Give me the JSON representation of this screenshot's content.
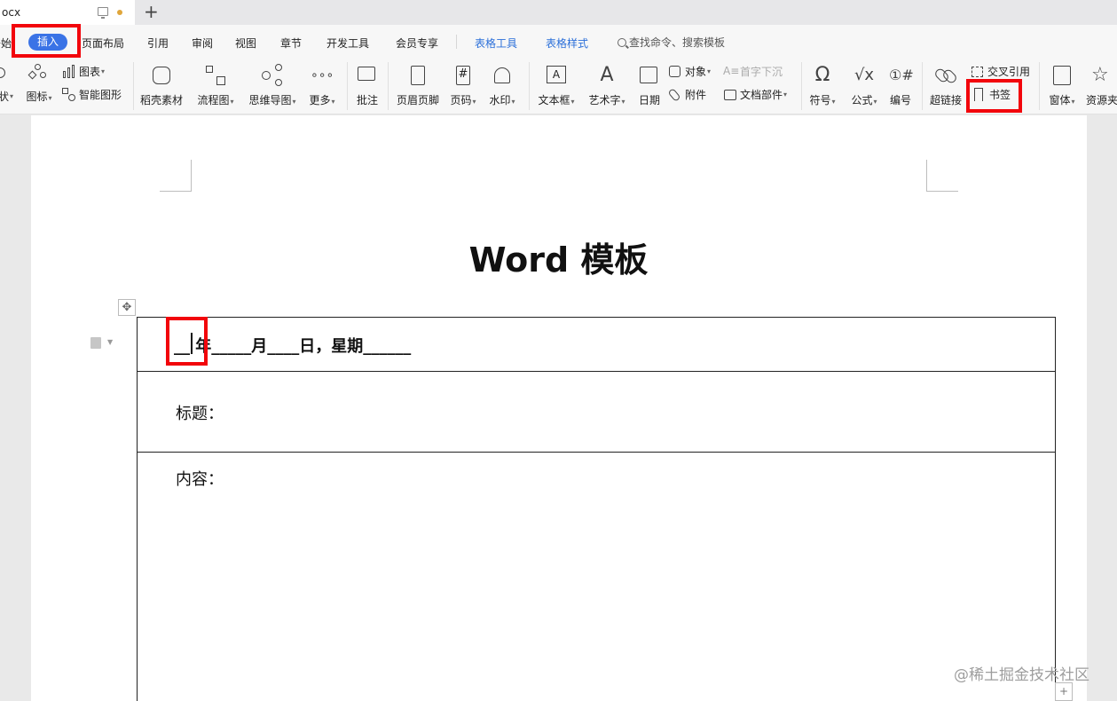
{
  "tab": {
    "doc_name": "ocx",
    "new_tab_label": "+"
  },
  "menu": {
    "start_partial": "开始",
    "insert": "插入",
    "layout": "页面布局",
    "reference": "引用",
    "review": "审阅",
    "view": "视图",
    "section": "章节",
    "dev": "开发工具",
    "member": "会员专享",
    "table_tools": "表格工具",
    "table_style": "表格样式",
    "search": "查找命令、搜索模板"
  },
  "ribbon": {
    "shape_partial": "状",
    "icon_lib": "图标",
    "chart": "图表",
    "smart_shape": "智能图形",
    "material": "稻壳素材",
    "flowchart": "流程图",
    "mindmap": "思维导图",
    "more": "更多",
    "comment": "批注",
    "header_footer": "页眉页脚",
    "page_num": "页码",
    "watermark": "水印",
    "textbox": "文本框",
    "wordart": "艺术字",
    "date": "日期",
    "object": "对象",
    "attachment": "附件",
    "dropcap": "首字下沉",
    "doc_parts": "文档部件",
    "symbol": "符号",
    "formula": "公式",
    "numbering": "编号",
    "hyperlink": "超链接",
    "crossref": "交叉引用",
    "bookmark": "书签",
    "form": "窗体",
    "resources_partial": "资源夹"
  },
  "document": {
    "title": "Word 模板",
    "date_line": "__ 年_____月____日，星期______",
    "subject_label": "标题：",
    "content_label": "内容："
  },
  "watermark": "@稀土掘金技术社区",
  "colors": {
    "accent": "#3a73e6",
    "highlight": "#f2050b",
    "table_tool_blue": "#2b6fd9"
  }
}
